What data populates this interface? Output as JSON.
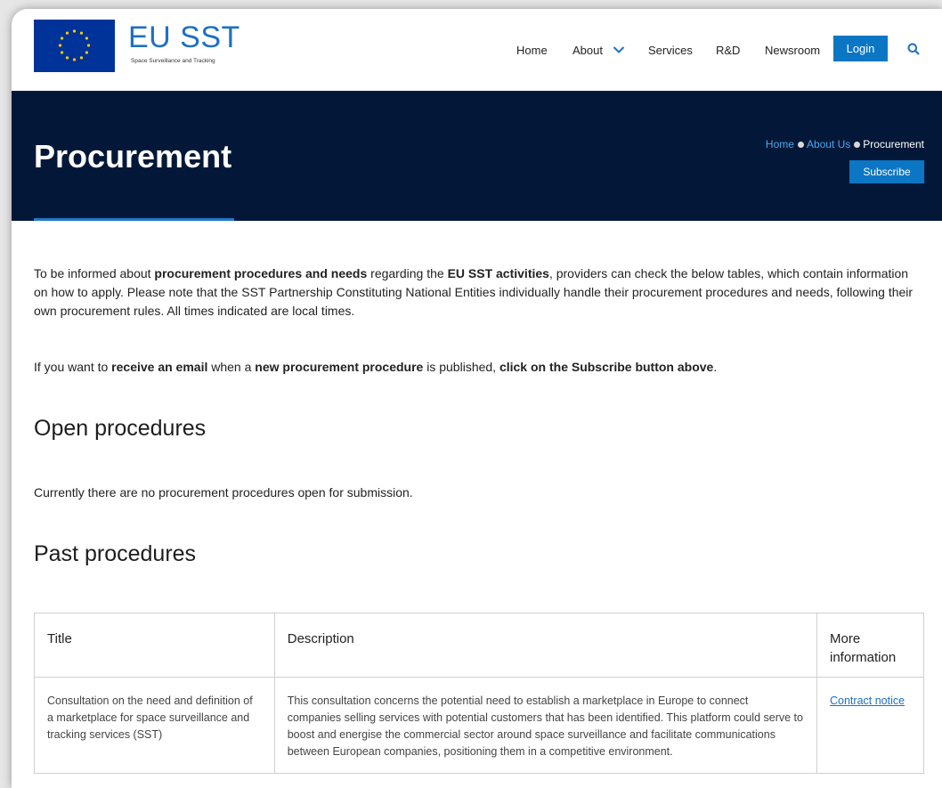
{
  "header": {
    "logo_title": "EU SST",
    "logo_subtitle": "Space Surveillance and Tracking",
    "nav": [
      {
        "label": "Home"
      },
      {
        "label": "About"
      },
      {
        "label": "Services"
      },
      {
        "label": "R&D"
      },
      {
        "label": "Newsroom"
      }
    ],
    "login_label": "Login"
  },
  "hero": {
    "title": "Procurement",
    "breadcrumb": [
      "Home",
      "About Us",
      "Procurement"
    ],
    "subscribe_label": "Subscribe"
  },
  "intro": {
    "p1_a": "To be informed about ",
    "p1_b": "procurement procedures and needs",
    "p1_c": " regarding the ",
    "p1_d": "EU SST activities",
    "p1_e": ", providers can check the below tables, which contain information on how to apply. Please note that the SST Partnership Constituting National Entities individually handle their procurement procedures and needs, following their own procurement rules. All times indicated are local times.",
    "p2_a": "If you want to ",
    "p2_b": "receive an email",
    "p2_c": " when a ",
    "p2_d": "new procurement procedure",
    "p2_e": " is published, ",
    "p2_f": "click on the Subscribe button above",
    "p2_g": "."
  },
  "open": {
    "heading": "Open procedures",
    "text": "Currently there are no procurement procedures open for submission."
  },
  "past": {
    "heading": "Past procedures",
    "columns": [
      "Title",
      "Description",
      "More information"
    ],
    "rows": [
      {
        "title": "Consultation on the need and definition of a marketplace for space surveillance and tracking services (SST)",
        "description": "This consultation concerns the potential need to establish a marketplace in Europe to connect companies selling services with potential customers that has been identified. This platform could serve to boost and energise the commercial sector around space surveillance and facilitate communications between European companies, positioning them in a competitive environment.",
        "link": "Contract notice"
      }
    ]
  },
  "colors": {
    "accent": "#0b76c3",
    "hero_bg": "#031838",
    "logo_blue": "#1e6fc4"
  }
}
